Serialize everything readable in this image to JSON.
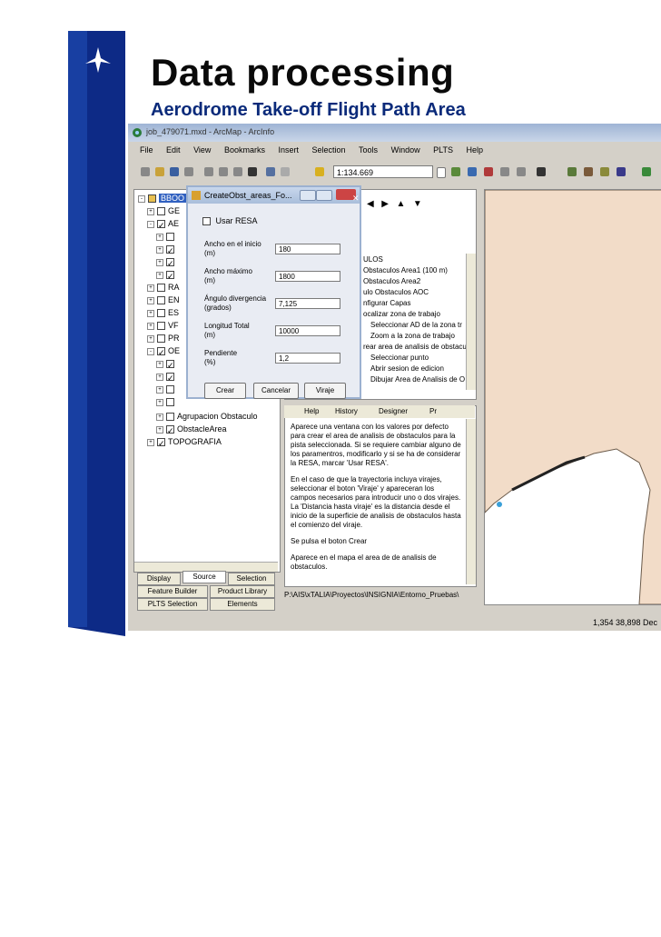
{
  "slide": {
    "title": "Data processing",
    "subtitle": "Aerodrome Take-off Flight Path Area"
  },
  "app": {
    "window_title": "job_479071.mxd - ArcMap - ArcInfo",
    "menu": [
      "File",
      "Edit",
      "View",
      "Bookmarks",
      "Insert",
      "Selection",
      "Tools",
      "Window",
      "PLTS",
      "Help"
    ],
    "scale": "1:134.669"
  },
  "toc": {
    "items": [
      {
        "label": "BBOO",
        "checked": true
      },
      {
        "label": "GE",
        "checked": false
      },
      {
        "label": "AE",
        "checked": true
      },
      {
        "label": "",
        "checked": false
      },
      {
        "label": "",
        "checked": true
      },
      {
        "label": "",
        "checked": true
      },
      {
        "label": "",
        "checked": true
      },
      {
        "label": "RA",
        "checked": false
      },
      {
        "label": "EN",
        "checked": false
      },
      {
        "label": "ES",
        "checked": false
      },
      {
        "label": "VF",
        "checked": false
      },
      {
        "label": "PR",
        "checked": false
      },
      {
        "label": "OE",
        "checked": true
      },
      {
        "label": "",
        "checked": true
      },
      {
        "label": "",
        "checked": true
      },
      {
        "label": "",
        "checked": false
      },
      {
        "label": "",
        "checked": false
      },
      {
        "label": "Agrupacion Obstaculo",
        "checked": false
      },
      {
        "label": "ObstacleArea",
        "checked": true
      },
      {
        "label": "TOPOGRAFIA",
        "checked": true
      }
    ],
    "tabs": [
      "Display",
      "Source",
      "Selection",
      "Feature Builder",
      "Product Library",
      "PLTS Selection",
      "Elements"
    ]
  },
  "dialog": {
    "title": "CreateObst_areas_Fo...",
    "use_resa_label": "Usar RESA",
    "use_resa_checked": false,
    "fields": [
      {
        "label": "Ancho en el inicio\n(m)",
        "value": "180"
      },
      {
        "label": "Ancho máximo\n(m)",
        "value": "1800"
      },
      {
        "label": "Ángulo divergencia\n(grados)",
        "value": "7,125"
      },
      {
        "label": "Longitud Total\n(m)",
        "value": "10000"
      },
      {
        "label": "Pendiente\n(%)",
        "value": "1,2"
      }
    ],
    "buttons": [
      "Crear",
      "Cancelar",
      "Viraje"
    ]
  },
  "tasks": {
    "lines": [
      "ULOS",
      "Obstaculos Area1 (100 m)",
      "Obstaculos Area2",
      "ulo Obstaculos AOC",
      "nfigurar Capas",
      "ocalizar zona de trabajo",
      "Seleccionar AD de la zona tr",
      "Zoom a la zona de trabajo",
      "rear area de analisis de obstacu",
      "Seleccionar punto",
      "Abrir sesion de edicion",
      "Dibujar Area de Analisis de O"
    ]
  },
  "help": {
    "tabs": [
      "Help",
      "History",
      "Designer",
      "Pr"
    ],
    "paragraphs": [
      "Aparece una ventana con los valores por defecto para crear el area de analisis de obstaculos para la pista seleccionada. Si se requiere cambiar alguno de los paramentros, modificarlo y si se ha de considerar la RESA, marcar 'Usar RESA'.",
      "En el caso de que la trayectoria incluya virajes, seleccionar el boton 'Viraje' y apareceran los campos necesarios para introducir uno o dos virajes. La 'Distancia hasta viraje' es la distancia desde el inicio de la superficie de analisis de obstaculos hasta el comienzo del viraje.",
      "Se pulsa el boton Crear",
      "Aparece en el mapa el area de de analisis de obstaculos."
    ],
    "path": "P:\\AIS\\xTALIA\\Proyectos\\INSIGNIA\\Entorno_Pruebas\\"
  },
  "status": {
    "coords": "1,354  38,898 Dec"
  },
  "colors": {
    "brand_blue": "#0d2a86",
    "land": "#f2dcc8",
    "sea": "#ffffff"
  }
}
